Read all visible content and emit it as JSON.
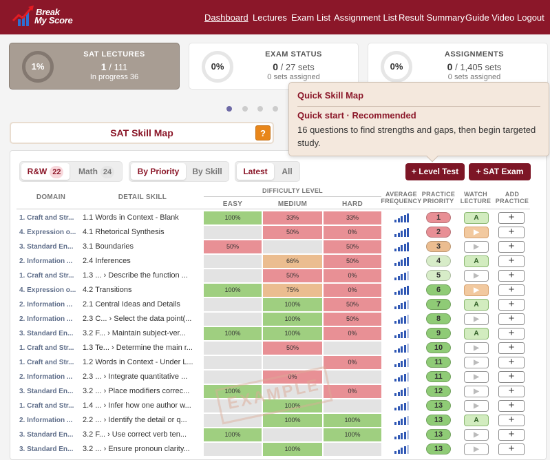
{
  "brand": {
    "line1": "Break",
    "line2": "My Score"
  },
  "nav": {
    "dashboard": "Dashboard",
    "lectures": "Lectures",
    "exam_list": "Exam List",
    "assignment_list": "Assignment List",
    "result_summary": "Result Summary",
    "guide_video": "Guide Video",
    "logout": "Logout"
  },
  "stats": [
    {
      "pct": "1%",
      "title": "SAT LECTURES",
      "value": "1",
      "total": "/ 111",
      "sub": "In progress 36"
    },
    {
      "pct": "0%",
      "title": "EXAM STATUS",
      "value": "0",
      "total": "/ 27 sets",
      "sub": "0 sets assigned"
    },
    {
      "pct": "0%",
      "title": "ASSIGNMENTS",
      "value": "0",
      "total": "/ 1,405 sets",
      "sub": "0 sets assigned"
    }
  ],
  "skill_map_button": "SAT Skill Map",
  "help_glyph": "?",
  "tooltip": {
    "title": "Quick Skill Map",
    "subtitle": "Quick start · Recommended",
    "body": "16 questions to find strengths and gaps, then begin targeted study."
  },
  "filters": {
    "rw": "R&W",
    "rw_count": "22",
    "math": "Math",
    "math_count": "24",
    "by_priority": "By Priority",
    "by_skill": "By Skill",
    "latest": "Latest",
    "all": "All"
  },
  "actions": {
    "level_test": "+ Level Test",
    "sat_exam": "+ SAT Exam"
  },
  "headers": {
    "domain": "DOMAIN",
    "detail": "DETAIL SKILL",
    "difficulty": "DIFFICULTY LEVEL",
    "easy": "EASY",
    "medium": "MEDIUM",
    "hard": "HARD",
    "avg1": "AVERAGE",
    "avg2": "FREQUENCY",
    "pp1": "PRACTICE",
    "pp2": "PRIORITY",
    "wl1": "WATCH",
    "wl2": "LECTURE",
    "ap1": "ADD",
    "ap2": "PRACTICE"
  },
  "watermark": "EXAMPLE",
  "colors": {
    "brand": "#8b1729",
    "good": "#9fcf80",
    "bad": "#e89095",
    "mid": "#ebbd90",
    "empty": "#e3e3e3"
  },
  "rows": [
    {
      "domain": "1. Craft and Str...",
      "detail": "1.1 Words in Context - Blank",
      "easy": "100%",
      "medium": "33%",
      "hard": "33%",
      "freq": 5,
      "priority": "1",
      "lecture": "A"
    },
    {
      "domain": "4. Expression o...",
      "detail": "4.1 Rhetorical Synthesis",
      "easy": "",
      "medium": "50%",
      "hard": "0%",
      "freq": 5,
      "priority": "2",
      "lecture": "▶"
    },
    {
      "domain": "3. Standard En...",
      "detail": "3.1 Boundaries",
      "easy": "50%",
      "medium": "",
      "hard": "50%",
      "freq": 5,
      "priority": "3",
      "lecture": "▶"
    },
    {
      "domain": "2. Information ...",
      "detail": "2.4 Inferences",
      "easy": "",
      "medium": "66%",
      "hard": "50%",
      "freq": 5,
      "priority": "4",
      "lecture": "A"
    },
    {
      "domain": "1. Craft and Str...",
      "detail": "1.3 ...   › Describe the function ...",
      "easy": "",
      "medium": "50%",
      "hard": "0%",
      "freq": 4,
      "priority": "5",
      "lecture": "▶"
    },
    {
      "domain": "4. Expression o...",
      "detail": "4.2 Transitions",
      "easy": "100%",
      "medium": "75%",
      "hard": "0%",
      "freq": 5,
      "priority": "6",
      "lecture": "▶"
    },
    {
      "domain": "2. Information ...",
      "detail": "2.1 Central Ideas and Details",
      "easy": "",
      "medium": "100%",
      "hard": "50%",
      "freq": 4,
      "priority": "7",
      "lecture": "A"
    },
    {
      "domain": "2. Information ...",
      "detail": "2.3 C...  › Select the data point(...",
      "easy": "",
      "medium": "100%",
      "hard": "50%",
      "freq": 4,
      "priority": "8",
      "lecture": "▶"
    },
    {
      "domain": "3. Standard En...",
      "detail": "3.2 F...  › Maintain subject-ver...",
      "easy": "100%",
      "medium": "100%",
      "hard": "0%",
      "freq": 4,
      "priority": "9",
      "lecture": "A"
    },
    {
      "domain": "1. Craft and Str...",
      "detail": "1.3 Te...  › Determine the main r...",
      "easy": "",
      "medium": "50%",
      "hard": "",
      "freq": 4,
      "priority": "10",
      "lecture": "▶"
    },
    {
      "domain": "1. Craft and Str...",
      "detail": "1.2 Words in Context - Under L...",
      "easy": "",
      "medium": "",
      "hard": "0%",
      "freq": 4,
      "priority": "11",
      "lecture": "▶"
    },
    {
      "domain": "2. Information ...",
      "detail": "2.3 ...   › Integrate quantitative ...",
      "easy": "",
      "medium": "0%",
      "hard": "",
      "freq": 4,
      "priority": "11",
      "lecture": "▶"
    },
    {
      "domain": "3. Standard En...",
      "detail": "3.2 ...   › Place modifiers correc...",
      "easy": "100%",
      "medium": "",
      "hard": "0%",
      "freq": 4,
      "priority": "12",
      "lecture": "▶"
    },
    {
      "domain": "1. Craft and Str...",
      "detail": "1.4 ...   › Infer how one author w...",
      "easy": "",
      "medium": "100%",
      "hard": "",
      "freq": 4,
      "priority": "13",
      "lecture": "▶"
    },
    {
      "domain": "2. Information ...",
      "detail": "2.2 ...   › Identify the detail or q...",
      "easy": "",
      "medium": "100%",
      "hard": "100%",
      "freq": 4,
      "priority": "13",
      "lecture": "A"
    },
    {
      "domain": "3. Standard En...",
      "detail": "3.2 F...  › Use correct verb ten...",
      "easy": "100%",
      "medium": "",
      "hard": "100%",
      "freq": 4,
      "priority": "13",
      "lecture": "▶"
    },
    {
      "domain": "3. Standard En...",
      "detail": "3.2 ...   › Ensure pronoun clarity...",
      "easy": "",
      "medium": "100%",
      "hard": "",
      "freq": 4,
      "priority": "13",
      "lecture": "▶"
    }
  ]
}
